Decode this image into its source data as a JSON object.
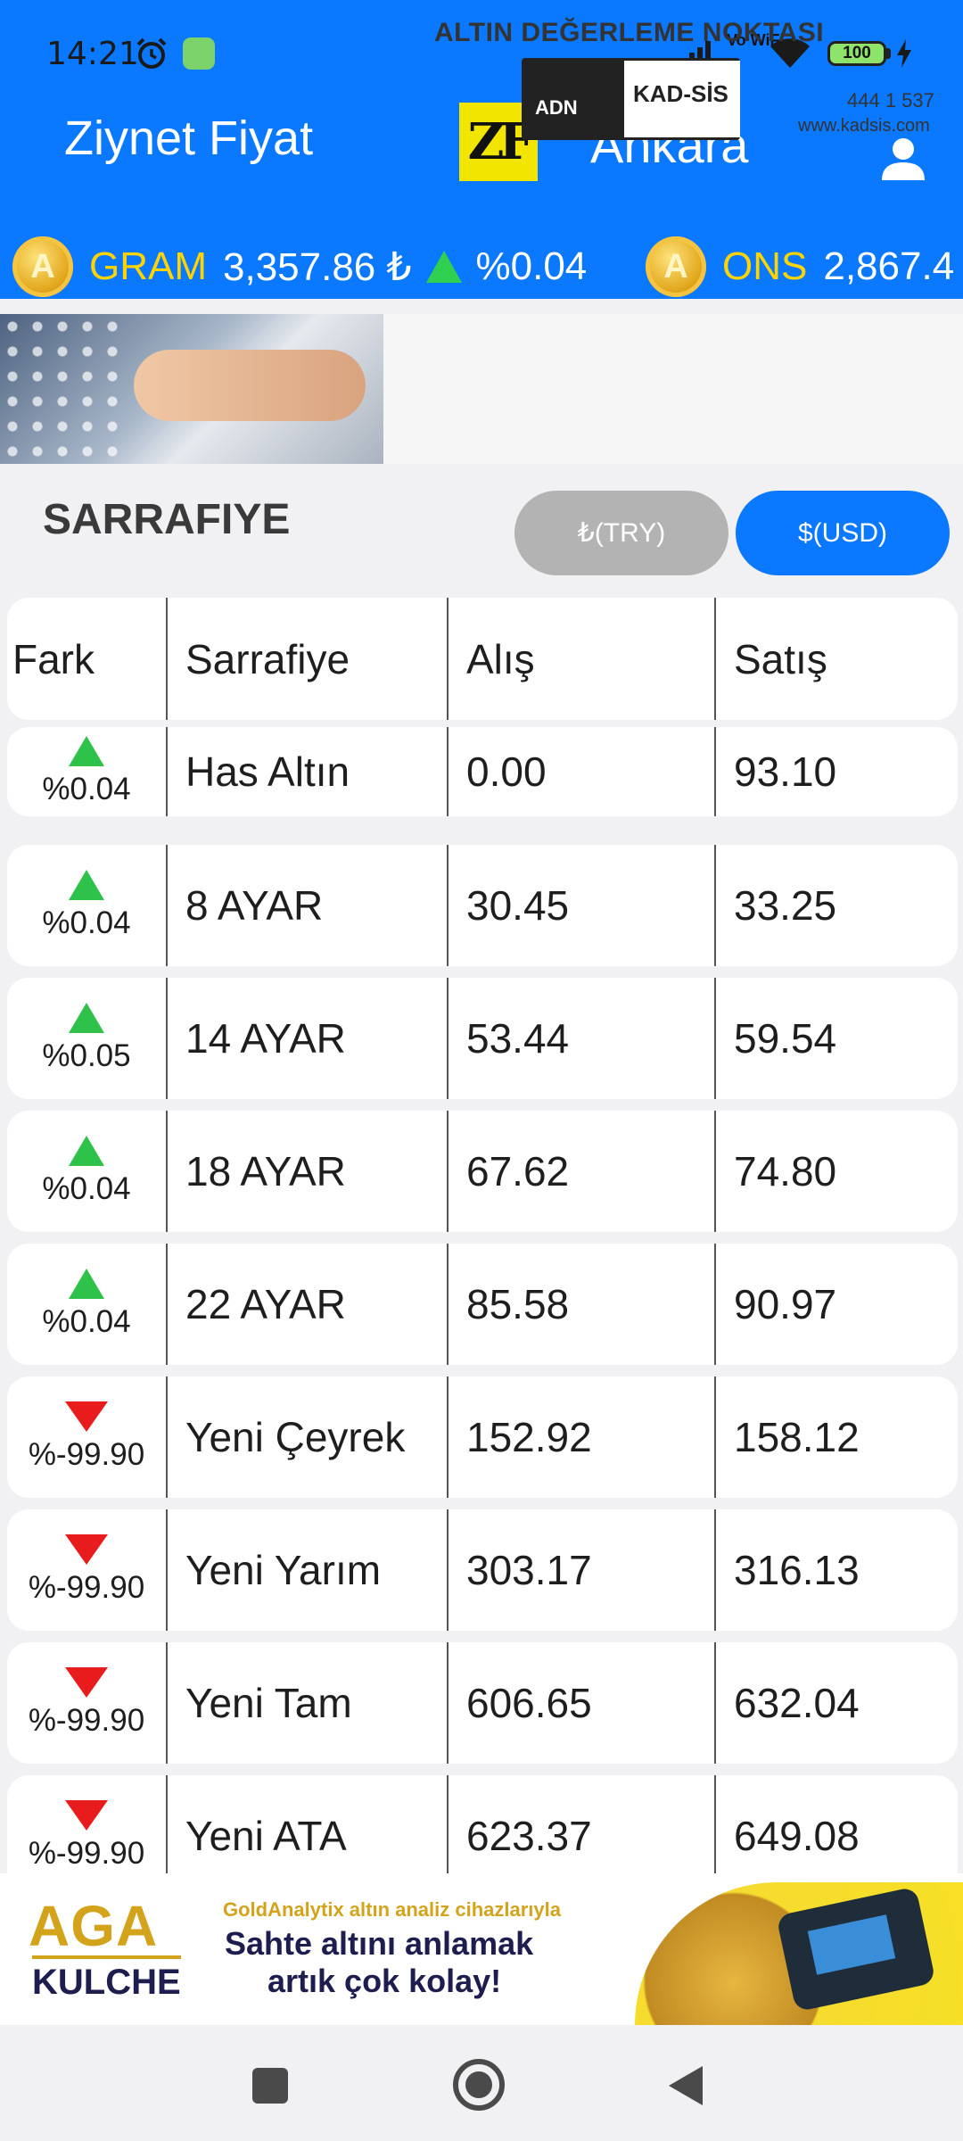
{
  "status_bar": {
    "time": "14:21",
    "vowifi": "Vo WiFi",
    "battery": "100",
    "icons": [
      "alarm-icon",
      "app-notification-icon",
      "signal-icon",
      "wifi-icon",
      "battery-icon",
      "charging-icon"
    ]
  },
  "header": {
    "app_title": "Ziynet Fiyat",
    "logo_text": "ZF",
    "city": "Ankara",
    "background_color": "#0a78ff"
  },
  "ticker": [
    {
      "name": "GRAM",
      "price": "3,357.86 ₺",
      "direction": "up",
      "change": "%0.04"
    },
    {
      "name": "ONS",
      "price": "2,867.4",
      "direction": "",
      "change": ""
    }
  ],
  "ad_top": {
    "title": "ALTIN DEĞERLEME NOKTASI",
    "brand_left": "ADN",
    "brand_right": "KAD-SİS",
    "phone": "444 1 537",
    "url": "www.kadsis.com"
  },
  "section": {
    "title": "SARRAFIYE",
    "try_label": "₺(TRY)",
    "usd_label": "$(USD)",
    "selected": "USD"
  },
  "table": {
    "columns": [
      "Fark",
      "Sarrafiye",
      "Alış",
      "Satış"
    ],
    "rows": [
      {
        "direction": "up",
        "change": "%0.04",
        "name": "Has Altın",
        "alis": "0.00",
        "satis": "93.10"
      },
      {
        "direction": "up",
        "change": "%0.04",
        "name": "8 AYAR",
        "alis": "30.45",
        "satis": "33.25"
      },
      {
        "direction": "up",
        "change": "%0.05",
        "name": "14 AYAR",
        "alis": "53.44",
        "satis": "59.54"
      },
      {
        "direction": "up",
        "change": "%0.04",
        "name": "18 AYAR",
        "alis": "67.62",
        "satis": "74.80"
      },
      {
        "direction": "up",
        "change": "%0.04",
        "name": "22 AYAR",
        "alis": "85.58",
        "satis": "90.97"
      },
      {
        "direction": "down",
        "change": "%-99.90",
        "name": "Yeni Çeyrek",
        "alis": "152.92",
        "satis": "158.12"
      },
      {
        "direction": "down",
        "change": "%-99.90",
        "name": "Yeni Yarım",
        "alis": "303.17",
        "satis": "316.13"
      },
      {
        "direction": "down",
        "change": "%-99.90",
        "name": "Yeni Tam",
        "alis": "606.65",
        "satis": "632.04"
      },
      {
        "direction": "down",
        "change": "%-99.90",
        "name": "Yeni ATA",
        "alis": "623.37",
        "satis": "649.08"
      }
    ],
    "up_color": "#2fc24a",
    "down_color": "#e81c1c"
  },
  "ad_bottom": {
    "brand_top": "AGA",
    "brand_bottom": "KULCHE",
    "subtitle": "GoldAnalytix altın analiz cihazlarıyla",
    "line1": "Sahte altını anlamak",
    "line2": "artık çok kolay!"
  },
  "nav_bar": {
    "icons": [
      "recent-apps-icon",
      "home-icon",
      "back-icon"
    ]
  }
}
